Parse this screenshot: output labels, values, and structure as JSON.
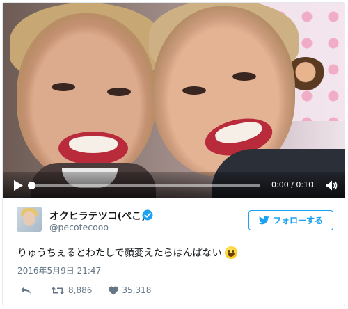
{
  "video": {
    "time_display": "0:00 / 0:10",
    "progress": 0,
    "play_icon": "play-icon",
    "volume_icon": "volume-icon"
  },
  "author": {
    "display_name": "オクヒラテツコ(ぺこ)",
    "handle": "@pecotecooo",
    "verified": true
  },
  "follow_button": {
    "label": "フォローする",
    "icon": "twitter-bird-icon"
  },
  "tweet": {
    "text": "りゅうちぇるとわたしで顔変えたらはんぱない",
    "emoji": "grinning-face-emoji",
    "timestamp": "2016年5月9日 21:47"
  },
  "actions": {
    "retweets": "8,886",
    "likes": "35,318"
  },
  "colors": {
    "accent": "#1da1f2",
    "muted": "#657786",
    "text": "#14171a",
    "border": "#e1e8ed"
  }
}
